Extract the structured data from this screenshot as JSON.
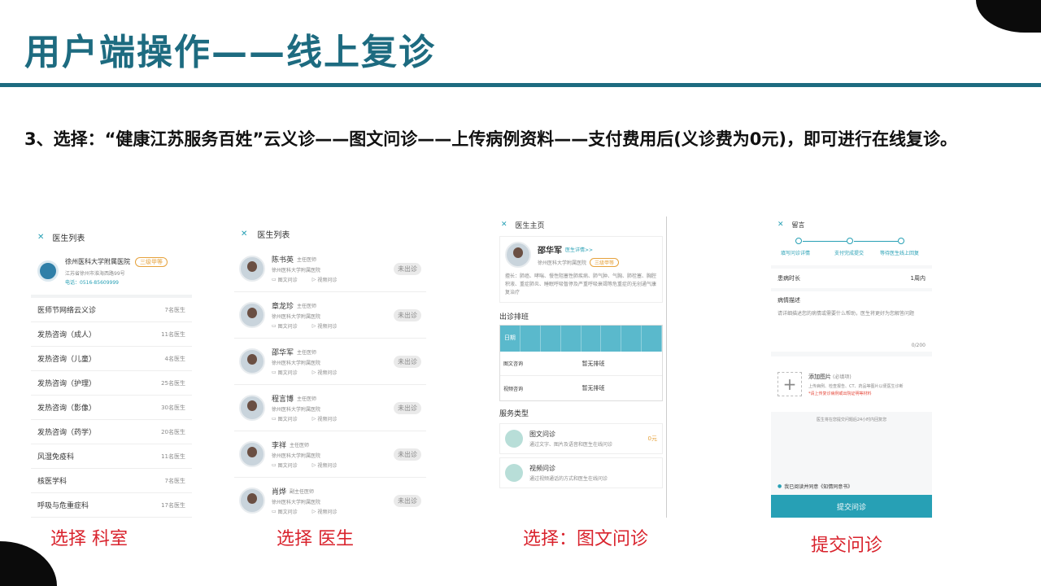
{
  "slide": {
    "title": "用户端操作——线上复诊",
    "description": "3、选择：“健康江苏服务百姓”云义诊——图文问诊——上传病例资料——支付费用后(义诊费为0元)，即可进行在线复诊。"
  },
  "captions": [
    "选择 科室",
    "选择 医生",
    "选择：图文问诊",
    "提交问诊"
  ],
  "panel1": {
    "header": "医生列表",
    "hospital": {
      "name": "徐州医科大学附属医院",
      "badge": "三级甲等",
      "address": "江苏省徐州市淮海西路99号",
      "phone": "电话：0516-85609999"
    },
    "departments": [
      {
        "name": "医师节网络云义诊",
        "count": "7名医生"
      },
      {
        "name": "发热咨询（成人）",
        "count": "11名医生"
      },
      {
        "name": "发热咨询（儿童）",
        "count": "4名医生"
      },
      {
        "name": "发热咨询（护理）",
        "count": "25名医生"
      },
      {
        "name": "发热咨询（影像）",
        "count": "30名医生"
      },
      {
        "name": "发热咨询（药学）",
        "count": "20名医生"
      },
      {
        "name": "风湿免疫科",
        "count": "11名医生"
      },
      {
        "name": "核医学科",
        "count": "7名医生"
      },
      {
        "name": "呼吸与危重症科",
        "count": "17名医生"
      }
    ]
  },
  "panel2": {
    "header": "医生列表",
    "doctors": [
      {
        "name": "陈书英",
        "title": "主任医师",
        "hospital": "徐州医科大学附属医院",
        "svc1": "图文问诊",
        "svc2": "视频问诊",
        "status": "未出诊"
      },
      {
        "name": "章龙珍",
        "title": "主任医师",
        "hospital": "徐州医科大学附属医院",
        "svc1": "图文问诊",
        "svc2": "视频问诊",
        "status": "未出诊"
      },
      {
        "name": "邵华军",
        "title": "主任医师",
        "hospital": "徐州医科大学附属医院",
        "svc1": "图文问诊",
        "svc2": "视频问诊",
        "status": "未出诊"
      },
      {
        "name": "程言博",
        "title": "主任医师",
        "hospital": "徐州医科大学附属医院",
        "svc1": "图文问诊",
        "svc2": "视频问诊",
        "status": "未出诊"
      },
      {
        "name": "李祥",
        "title": "主任医师",
        "hospital": "徐州医科大学附属医院",
        "svc1": "图文问诊",
        "svc2": "视频问诊",
        "status": "未出诊"
      },
      {
        "name": "肖烨",
        "title": "副主任医师",
        "hospital": "徐州医科大学附属医院",
        "svc1": "图文问诊",
        "svc2": "视频问诊",
        "status": "未出诊"
      }
    ]
  },
  "panel3": {
    "header": "医生主页",
    "doctor_name": "邵华军",
    "detail_link": "医生详情>>",
    "hospital": "徐州医科大学附属医院",
    "badge": "三级甲等",
    "specialty": "擅长：肺癌、哮喘、慢性阻塞性肺疾病、肺气肿、气胸、肺栓塞、胸腔积液、重症肺炎、睡眠呼吸暂停及严重呼吸衰竭等危重症的无创通气康复治疗",
    "schedule_title": "出诊排班",
    "schedule_row0": "日期",
    "schedule_row1": "图文咨询",
    "schedule_row2": "视频咨询",
    "no_schedule": "暂无排班",
    "service_title": "服务类型",
    "service1": {
      "name": "图文问诊",
      "desc": "通过文字、图片及语音和医生在线问诊",
      "price": "0元"
    },
    "service2": {
      "name": "视频问诊",
      "desc": "通过视频通话的方式和医生在线问诊"
    }
  },
  "panel4": {
    "header": "留言",
    "steps": [
      "填写问诊详情",
      "支付完成提交",
      "等待医生线上回复"
    ],
    "duration_label": "患病时长",
    "duration_value": "1周内",
    "symptom_label": "病情描述",
    "symptom_placeholder": "请详细描述您的病情或需要什么帮助，医生将更好为您解答问题",
    "counter": "0/200",
    "add_image": "添加图片",
    "add_image_hint": "(必填项)",
    "image_note": "上传病例、检查报告、CT、药品等图片以便医生诊断",
    "warn_note": "*请上传复诊病例或出院证明等材料",
    "reply_note": "医生将在您提交问题后24小时内回复您",
    "agree_text": "我已阅读并同意《知情同意书》",
    "submit_label": "提交问诊"
  },
  "colors": {
    "title": "#1d6b80",
    "caption": "#d9232d",
    "accent": "#27a0b5"
  }
}
